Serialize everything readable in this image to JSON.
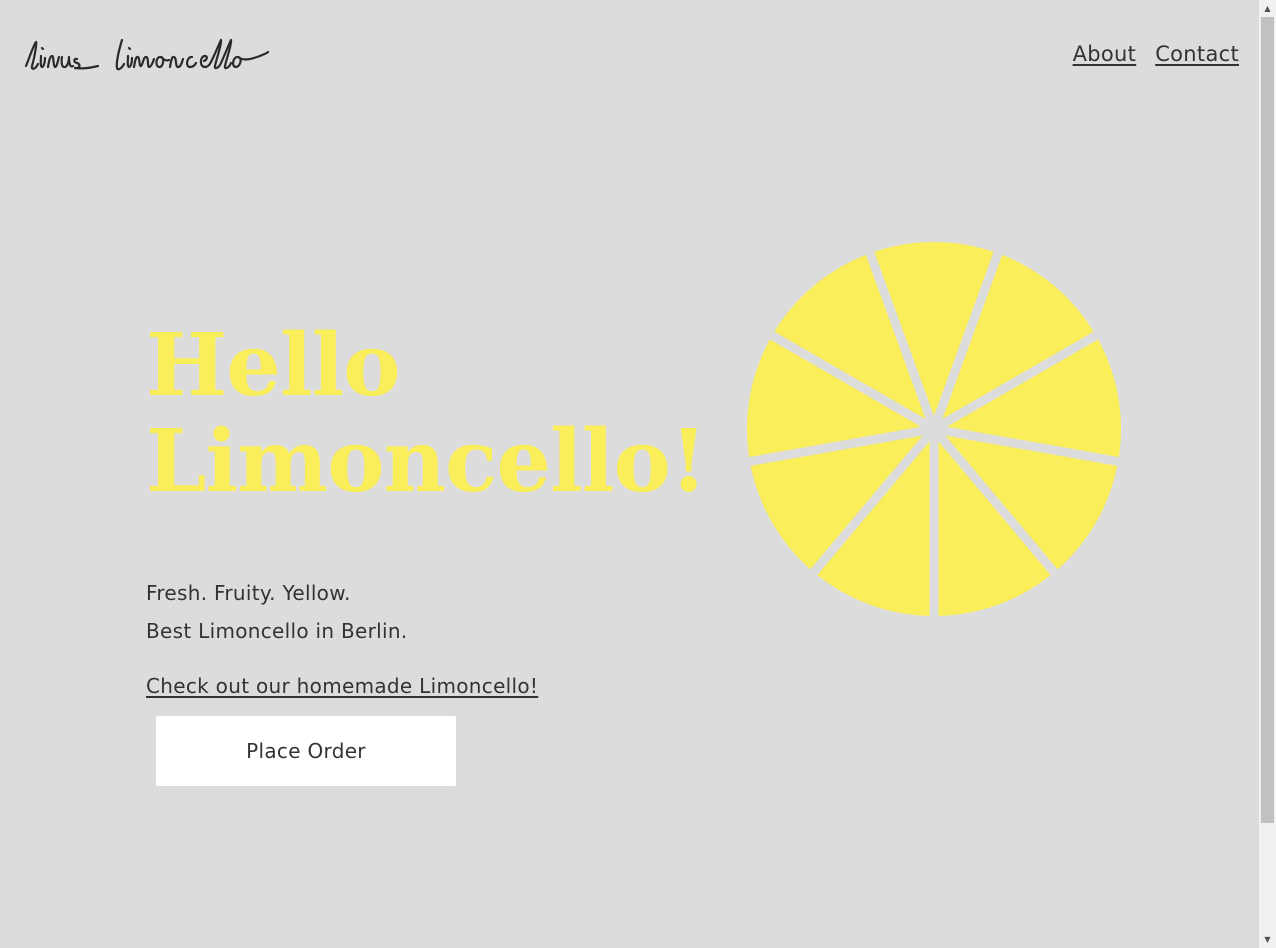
{
  "header": {
    "logo_text": "linus limoncello",
    "nav": [
      {
        "label": "About"
      },
      {
        "label": "Contact"
      }
    ]
  },
  "hero": {
    "title_line1": "Hello",
    "title_line2": "Limoncello!",
    "tagline_line1": "Fresh. Fruity. Yellow.",
    "tagline_line2": "Best Limoncello in Berlin.",
    "cta_link": "Check out our homemade Limoncello!",
    "order_button": "Place Order"
  },
  "colors": {
    "background": "#dcdcdc",
    "accent_yellow": "#fbee5b",
    "text": "#333333",
    "button_bg": "#ffffff"
  },
  "icons": {
    "lemon": "lemon-slice-icon",
    "scroll_up": "chevron-up-icon",
    "scroll_down": "chevron-down-icon"
  },
  "lemon_slice": {
    "segments": 9
  }
}
